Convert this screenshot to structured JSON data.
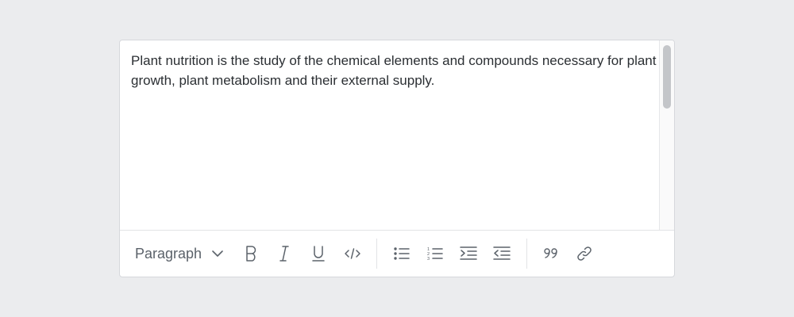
{
  "editor": {
    "content": "Plant nutrition is the study of the chemical elements and compounds necessary for plant growth, plant metabolism and their external supply."
  },
  "toolbar": {
    "block_format": {
      "selected": "Paragraph"
    },
    "buttons": [
      {
        "name": "bold",
        "icon": "bold-icon"
      },
      {
        "name": "italic",
        "icon": "italic-icon"
      },
      {
        "name": "underline",
        "icon": "underline-icon"
      },
      {
        "name": "code",
        "icon": "code-icon"
      },
      {
        "name": "bulleted-list",
        "icon": "bulleted-list-icon"
      },
      {
        "name": "numbered-list",
        "icon": "numbered-list-icon"
      },
      {
        "name": "indent",
        "icon": "indent-icon"
      },
      {
        "name": "outdent",
        "icon": "outdent-icon"
      },
      {
        "name": "blockquote",
        "icon": "quote-icon"
      },
      {
        "name": "link",
        "icon": "link-icon"
      }
    ]
  },
  "colors": {
    "background": "#ebecee",
    "editor_bg": "#ffffff",
    "text": "#2b2f33",
    "icon": "#5b626a",
    "border": "#d6d8dc"
  }
}
